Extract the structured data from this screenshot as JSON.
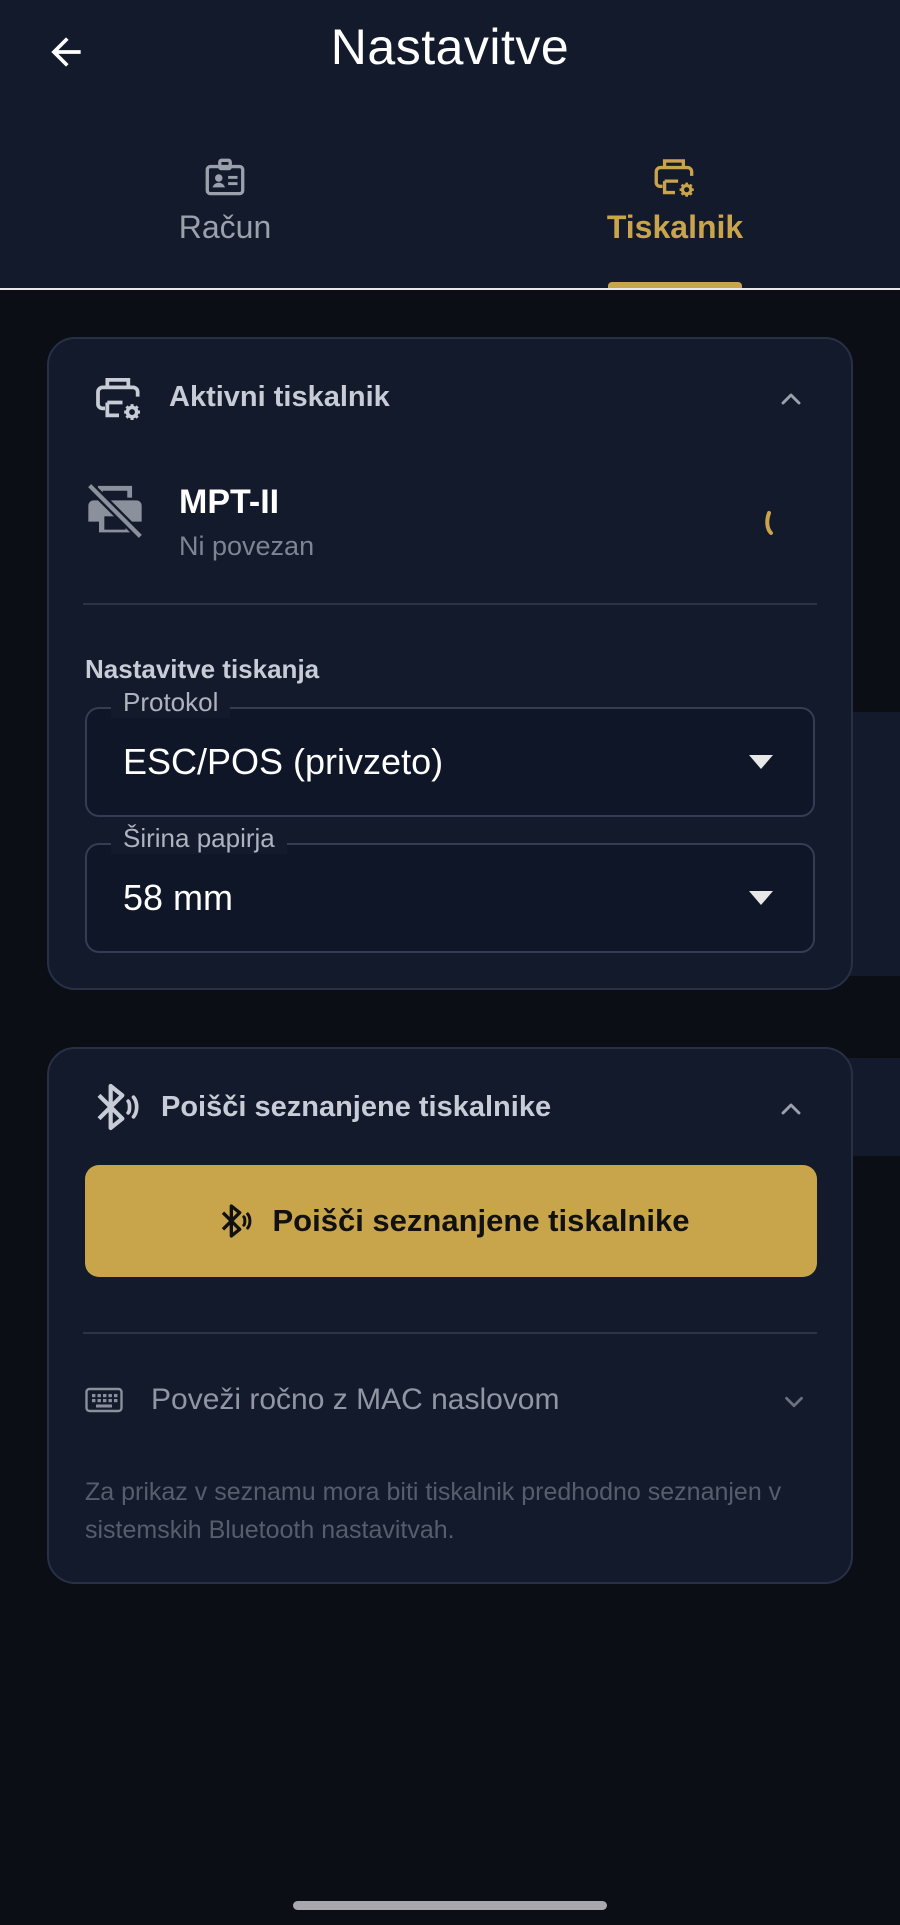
{
  "header": {
    "title": "Nastavitve",
    "back_icon": "arrow-back-icon"
  },
  "tabs": [
    {
      "label": "Račun",
      "icon": "id-badge-icon",
      "active": false
    },
    {
      "label": "Tiskalnik",
      "icon": "printer-settings-icon",
      "active": true
    }
  ],
  "active_printer": {
    "section_title": "Aktivni tiskalnik",
    "printer_name": "MPT-II",
    "status": "Ni povezan",
    "print_settings_title": "Nastavitve tiskanja",
    "protocol": {
      "label": "Protokol",
      "value": "ESC/POS (privzeto)"
    },
    "paper_width": {
      "label": "Širina papirja",
      "value": "58 mm"
    }
  },
  "paired": {
    "section_title": "Poišči seznanjene tiskalnike",
    "button_label": "Poišči seznanjene tiskalnike",
    "mac_label": "Poveži ročno z MAC naslovom",
    "hint": "Za prikaz v seznamu mora biti tiskalnik predhodno seznanjen v sistemskih Bluetooth nastavitvah."
  },
  "colors": {
    "accent": "#c9a44c",
    "background": "#0b0e14",
    "surface": "#131a2b"
  }
}
